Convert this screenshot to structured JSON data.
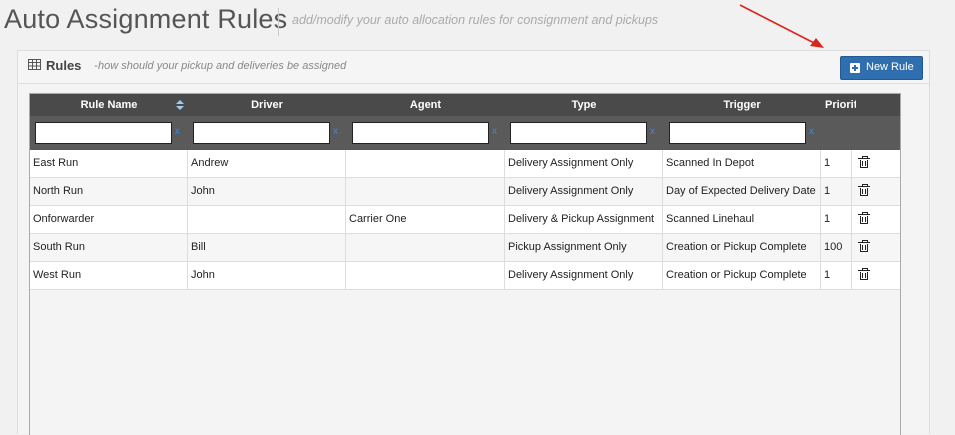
{
  "page": {
    "title": "Auto Assignment Rules",
    "subtitle": "add/modify your auto allocation rules for consignment and pickups"
  },
  "panel": {
    "title": "Rules",
    "subtitle": "how should your pickup and deliveries be assigned",
    "new_rule_label": "New Rule",
    "icons": {
      "table": "table-icon",
      "new_rule": "plus-square-icon",
      "delete": "trash-icon",
      "sort": "sort-icon"
    },
    "accent_color": "#2f6fb0",
    "annotation_arrow_color": "#d9261c"
  },
  "grid": {
    "columns": [
      "Rule Name",
      "Driver",
      "Agent",
      "Type",
      "Trigger",
      "Priority"
    ],
    "filters": {
      "clear_label": "x",
      "values": [
        "",
        "",
        "",
        "",
        ""
      ]
    },
    "rows": [
      {
        "rule_name": "East Run",
        "driver": "Andrew",
        "agent": "",
        "type": "Delivery Assignment Only",
        "trigger": "Scanned In Depot",
        "priority": "1"
      },
      {
        "rule_name": "North Run",
        "driver": "John",
        "agent": "",
        "type": "Delivery Assignment Only",
        "trigger": "Day of Expected Delivery Date",
        "priority": "1"
      },
      {
        "rule_name": "Onforwarder",
        "driver": "",
        "agent": "Carrier One",
        "type": "Delivery & Pickup Assignment",
        "trigger": "Scanned Linehaul",
        "priority": "1"
      },
      {
        "rule_name": "South Run",
        "driver": "Bill",
        "agent": "",
        "type": "Pickup Assignment Only",
        "trigger": "Creation or Pickup Complete",
        "priority": "100"
      },
      {
        "rule_name": "West Run",
        "driver": "John",
        "agent": "",
        "type": "Delivery Assignment Only",
        "trigger": "Creation or Pickup Complete",
        "priority": "1"
      }
    ]
  }
}
